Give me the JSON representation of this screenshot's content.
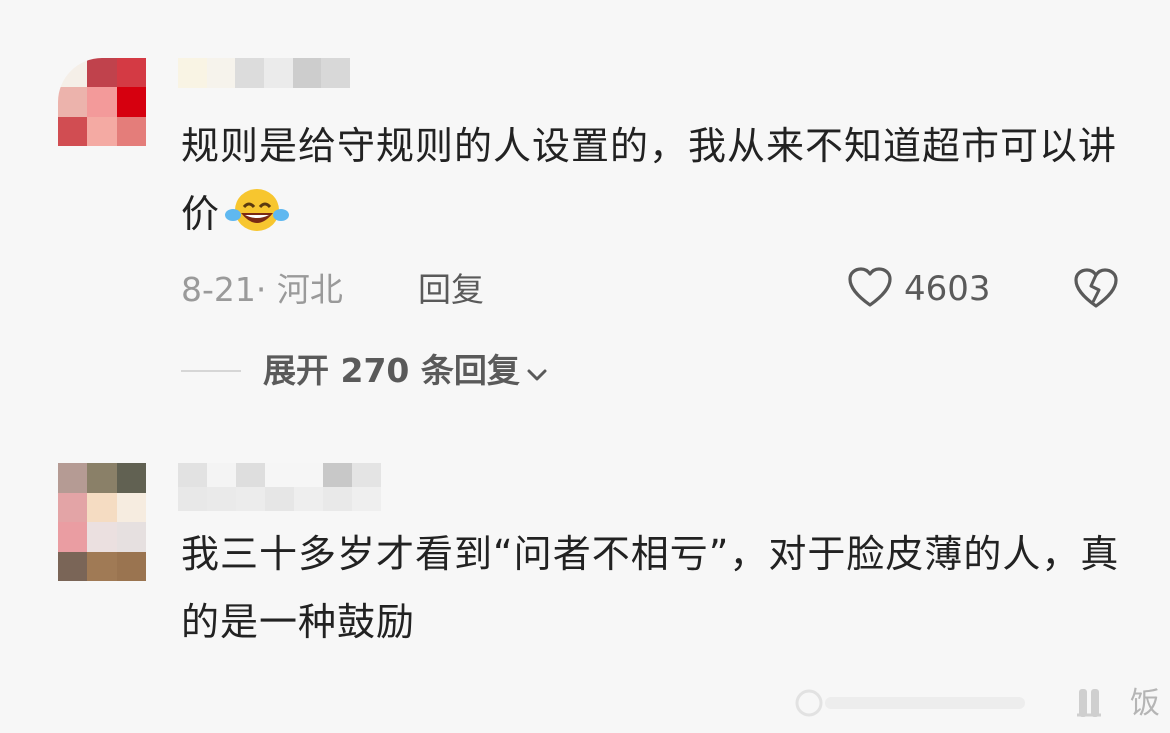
{
  "comments": [
    {
      "text": "规则是给守规则的人设置的，我从来不知道超市可以讲价",
      "emoji": "laughing-crying-emoji",
      "meta": "8-21· 河北",
      "reply_label": "回复",
      "likes": "4603",
      "expand_label": "展开 270 条回复"
    },
    {
      "text": "我三十多岁才看到“问者不相亏”，对于脸皮薄的人，真的是一种鼓励"
    }
  ],
  "watermark": {
    "text": "饭"
  },
  "colors": {
    "background": "#f7f7f7",
    "text": "#222222",
    "meta": "#9a9a9a",
    "action": "#5a5a5a"
  },
  "icons": [
    "heart-outline-icon",
    "broken-heart-icon",
    "chevron-down-icon"
  ]
}
